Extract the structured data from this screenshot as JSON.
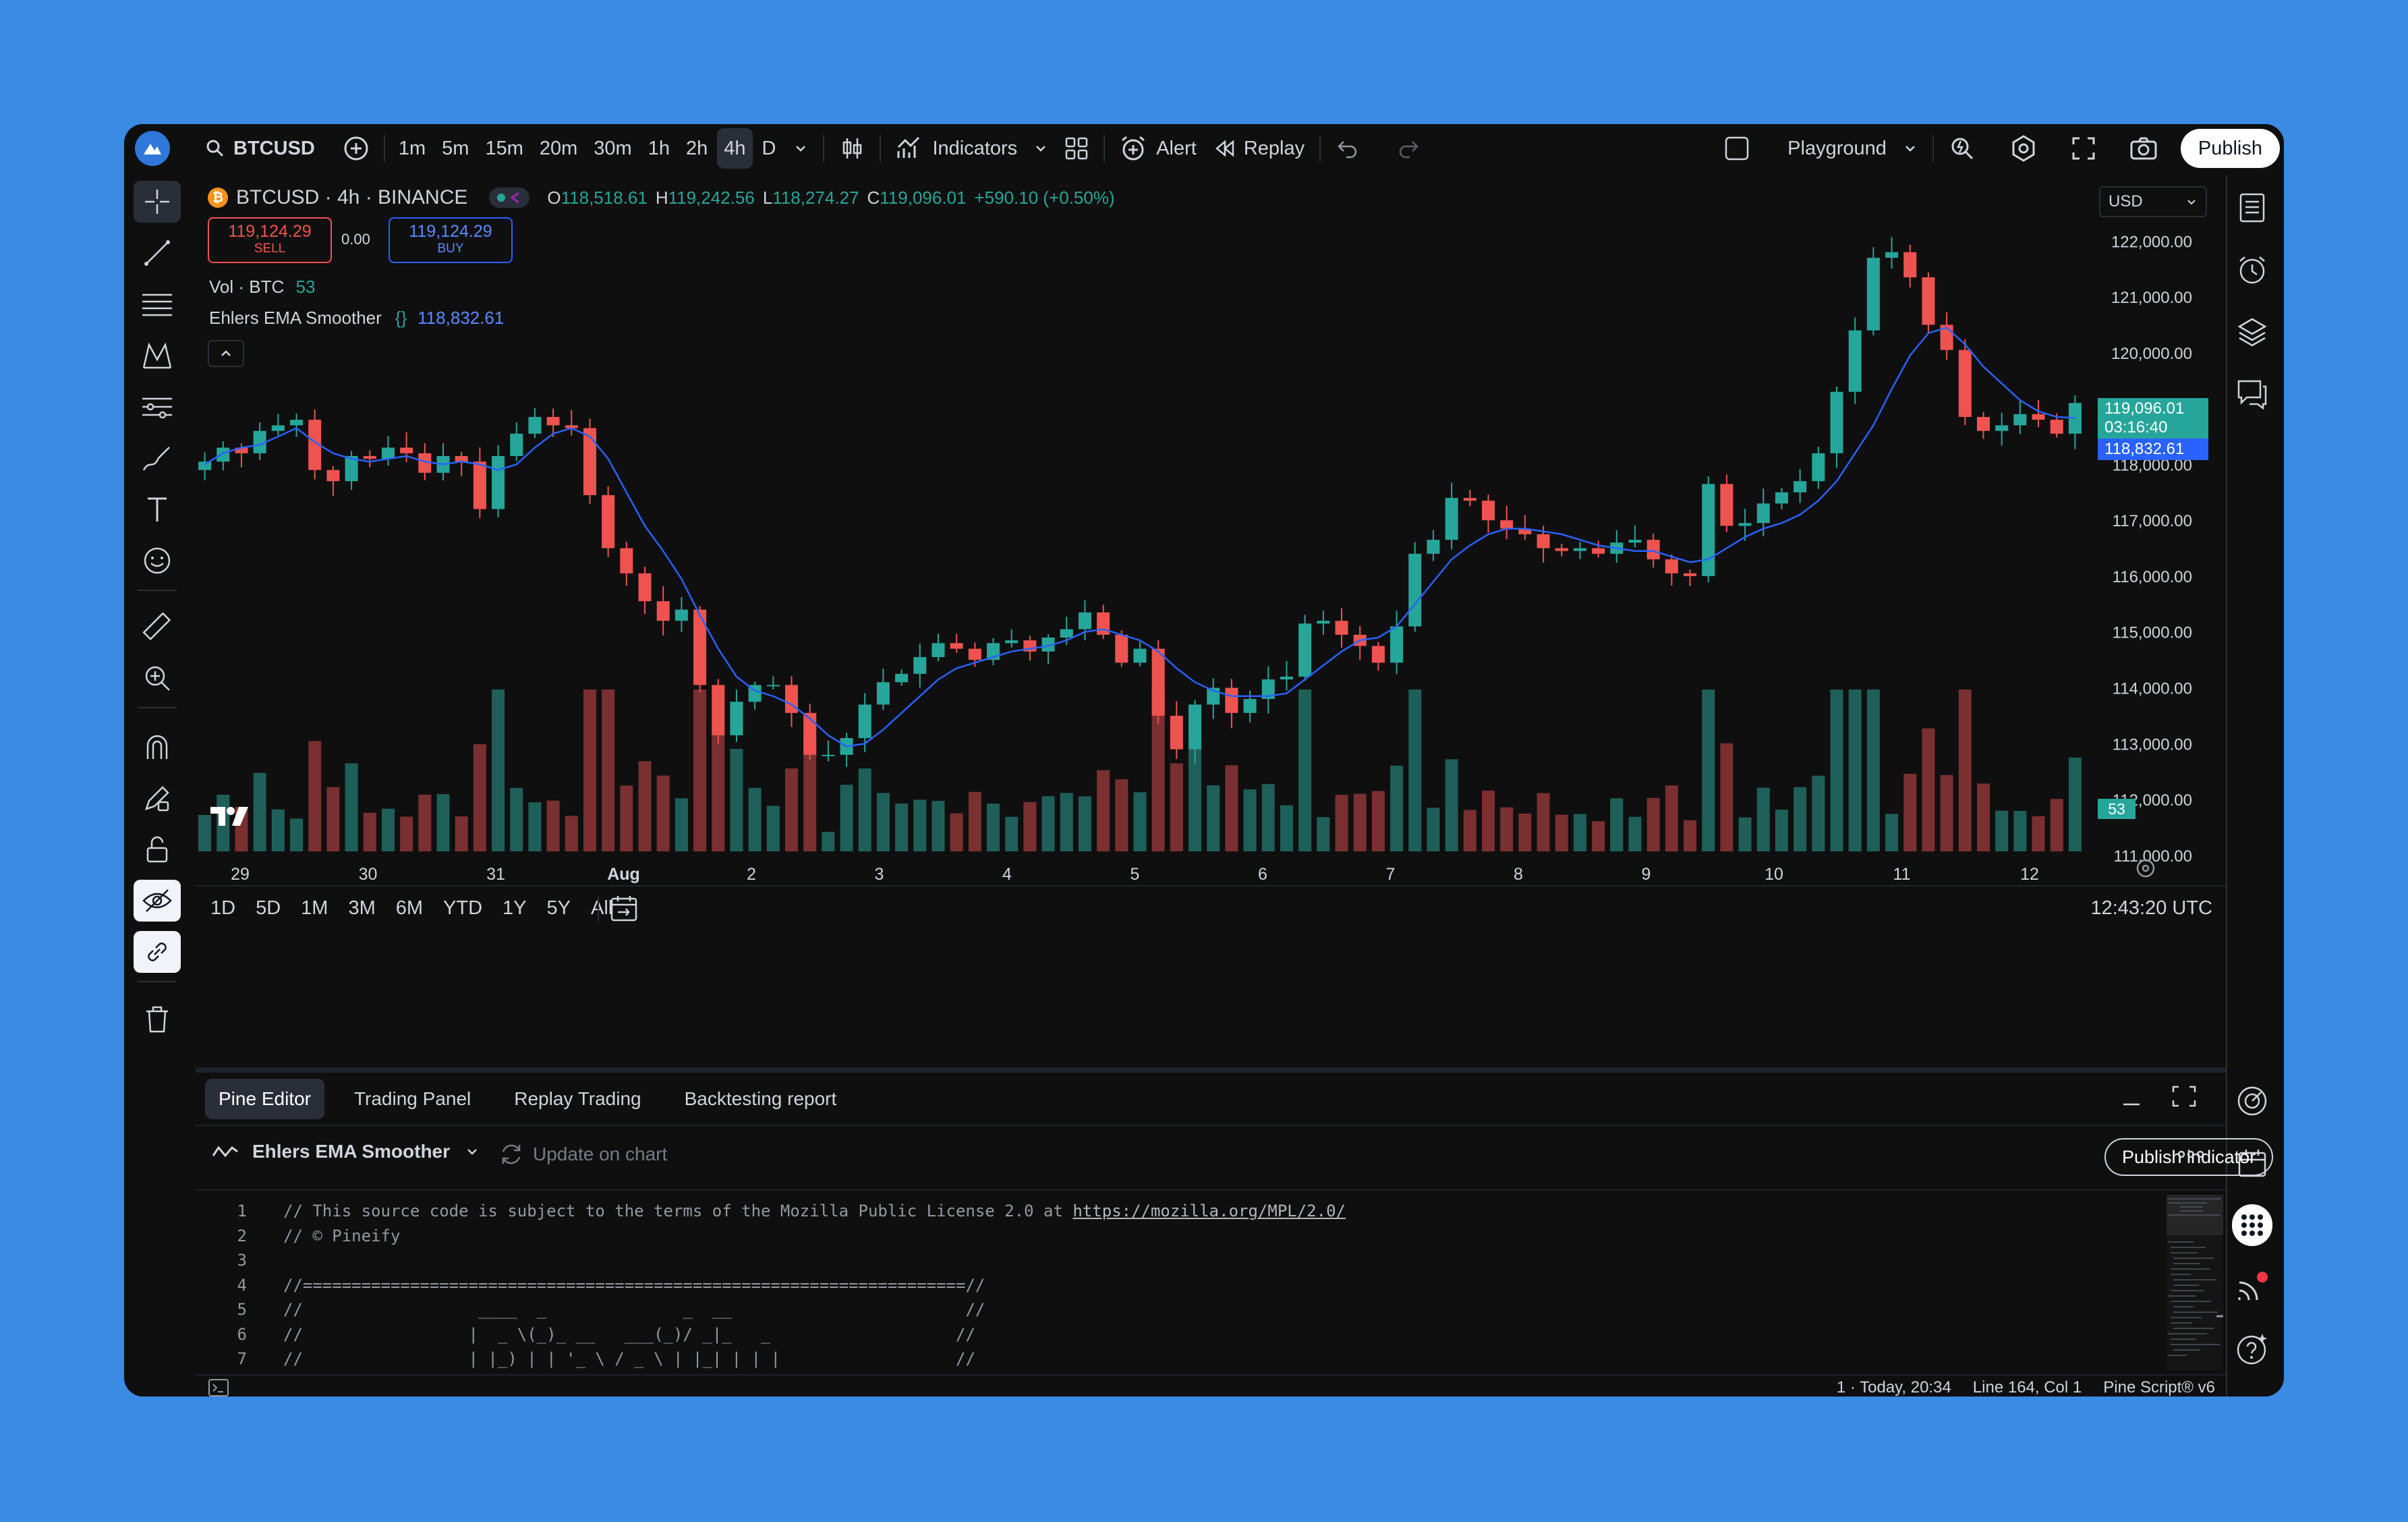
{
  "colors": {
    "bg": "#0f0f0f",
    "up": "#26a69a",
    "down": "#ef5350",
    "ema": "#2962ff",
    "accent": "#2962ff",
    "text": "#d1d4dc",
    "muted": "#787b86"
  },
  "toolbar": {
    "symbol": "BTCUSD",
    "intervals": [
      "1m",
      "5m",
      "15m",
      "20m",
      "30m",
      "1h",
      "2h",
      "4h",
      "D"
    ],
    "active_interval": "4h",
    "indicators_label": "Indicators",
    "alert_label": "Alert",
    "replay_label": "Replay",
    "layout_name": "Playground",
    "publish_label": "Publish"
  },
  "legend": {
    "title": "BTCUSD · 4h · BINANCE",
    "o_label": "O",
    "o_value": "118,518.61",
    "h_label": "H",
    "h_value": "119,242.56",
    "l_label": "L",
    "l_value": "118,274.27",
    "c_label": "C",
    "c_value": "119,096.01",
    "change": "+590.10 (+0.50%)",
    "sell_price": "119,124.29",
    "sell_label": "SELL",
    "spread": "0.00",
    "buy_price": "119,124.29",
    "buy_label": "BUY",
    "vol_label": "Vol · BTC",
    "vol_value": "53",
    "indicator_name": "Ehlers EMA Smoother",
    "indicator_value": "118,832.61"
  },
  "currency": "USD",
  "price_labels": {
    "last": "119,096.01",
    "countdown": "03:16:40",
    "ema": "118,832.61",
    "volume": "53"
  },
  "time_ranges": [
    "1D",
    "5D",
    "1M",
    "3M",
    "6M",
    "YTD",
    "1Y",
    "5Y",
    "All"
  ],
  "clock": "12:43:20 UTC",
  "bottom_tabs": [
    "Pine Editor",
    "Trading Panel",
    "Replay Trading",
    "Backtesting report"
  ],
  "editor": {
    "script_name": "Ehlers EMA Smoother",
    "update_label": "Update on chart",
    "publish_indicator": "Publish indicator",
    "lines": [
      "// This source code is subject to the terms of the Mozilla Public License 2.0 at https://mozilla.org/MPL/2.0/",
      "// © Pineify",
      "",
      "//====================================================================//",
      "//                  ____  _              _  __                        //",
      "//                 |  _ \\(_)_ __   ___(_)/ _|_   _                   //",
      "//                 | |_) | | '_ \\ / _ \\ | |_| | | |                  //",
      "//                 |  __/| | | | |  __/ |  _| |_| |                  //",
      "//                 |_|   |_|_| |_|\\___|_|_|  \\__, |                  //",
      "//                                           |___/                   //",
      "//====================================================================//",
      ""
    ]
  },
  "status": {
    "version": "1 · Today, 20:34",
    "position": "Line 164, Col 1",
    "language": "Pine Script® v6"
  },
  "chart_data": {
    "type": "candlestick",
    "price_axis_ticks": [
      "122,000.00",
      "121,000.00",
      "120,000.00",
      "119,000.00",
      "118,000.00",
      "117,000.00",
      "116,000.00",
      "115,000.00",
      "114,000.00",
      "113,000.00",
      "112,000.00",
      "111,000.00"
    ],
    "price_axis_range": [
      110950,
      122450
    ],
    "time_axis_ticks": [
      "29",
      "30",
      "31",
      "Aug",
      "2",
      "3",
      "4",
      "5",
      "6",
      "7",
      "8",
      "9",
      "10",
      "11",
      "12"
    ],
    "candle_interval": "4h",
    "closes": [
      118050,
      118300,
      118200,
      118600,
      118700,
      118800,
      117900,
      117700,
      118150,
      118100,
      118300,
      118200,
      117850,
      118150,
      118050,
      117200,
      118150,
      118550,
      118850,
      118700,
      118650,
      117450,
      116500,
      116050,
      115550,
      115200,
      115400,
      114050,
      113150,
      113750,
      114050,
      114050,
      113550,
      112800,
      112800,
      113100,
      113700,
      114100,
      114250,
      114550,
      114800,
      114700,
      114500,
      114800,
      114850,
      114650,
      114900,
      115050,
      115350,
      114950,
      114450,
      114700,
      113500,
      112900,
      113700,
      114000,
      113550,
      113800,
      114150,
      114200,
      115150,
      115200,
      114950,
      114750,
      114450,
      115100,
      116400,
      116650,
      117400,
      117350,
      117000,
      116850,
      116750,
      116500,
      116450,
      116500,
      116400,
      116600,
      116650,
      116300,
      116050,
      116000,
      117650,
      116900,
      116950,
      117300,
      117500,
      117700,
      118200,
      119300,
      120400,
      121700,
      121800,
      121350,
      120500,
      120050,
      118850,
      118600,
      118700,
      118900,
      118800,
      118550,
      119100
    ],
    "ema": [
      118000,
      118200,
      118300,
      118350,
      118500,
      118650,
      118400,
      118200,
      118100,
      118050,
      118100,
      118150,
      118050,
      118000,
      118050,
      118000,
      117900,
      118000,
      118300,
      118550,
      118650,
      118500,
      118100,
      117500,
      116900,
      116450,
      115950,
      115300,
      114700,
      114200,
      113950,
      113850,
      113700,
      113450,
      113150,
      112950,
      113000,
      113250,
      113550,
      113850,
      114150,
      114350,
      114450,
      114550,
      114650,
      114700,
      114750,
      114850,
      115000,
      115050,
      114950,
      114850,
      114650,
      114350,
      114100,
      113950,
      113850,
      113850,
      113850,
      113900,
      114150,
      114400,
      114650,
      114850,
      114900,
      115100,
      115500,
      115900,
      116300,
      116550,
      116750,
      116850,
      116850,
      116800,
      116750,
      116650,
      116550,
      116500,
      116450,
      116450,
      116350,
      116250,
      116300,
      116500,
      116700,
      116850,
      116950,
      117100,
      117350,
      117700,
      118200,
      118700,
      119350,
      119950,
      120350,
      120450,
      120150,
      119750,
      119450,
      119150,
      118950,
      118850,
      118832.61
    ],
    "last_close": 119096.01,
    "ema_last": 118832.61
  }
}
